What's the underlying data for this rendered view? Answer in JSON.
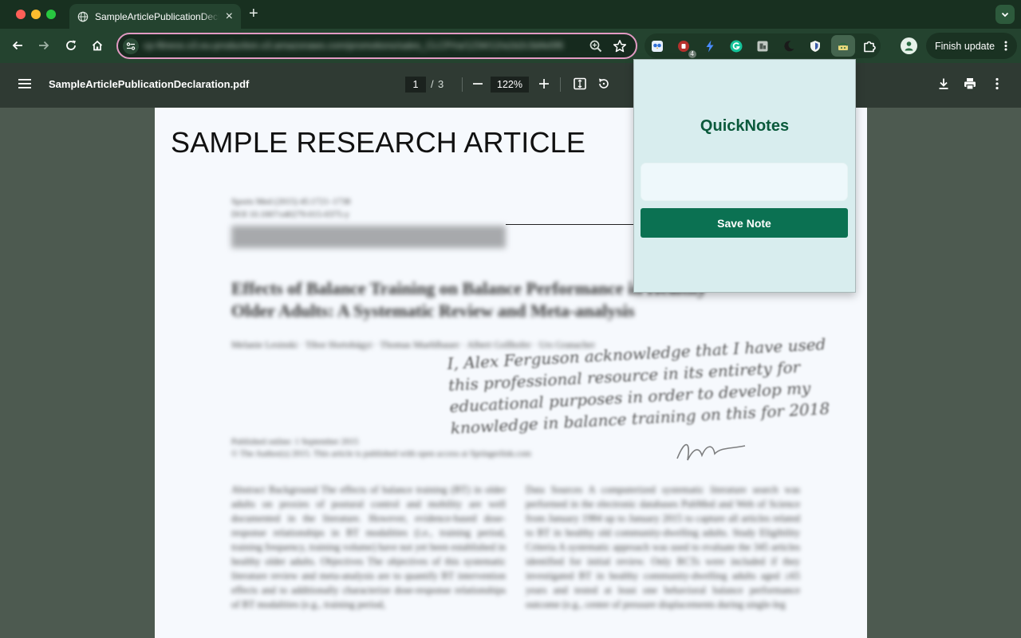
{
  "browser": {
    "tab": {
      "title": "SampleArticlePublicationDeclaration"
    },
    "address_bar": {
      "url": "cp-fitness.s3.eu-production.s3.amazonaws.com/promotions/sales_CLCP/ra/1234/12/a1b2c3d4e5f6"
    },
    "finish_update_label": "Finish update",
    "extension_badge_count": "4"
  },
  "pdf_viewer": {
    "filename": "SampleArticlePublicationDeclaration.pdf",
    "current_page": "1",
    "page_separator": "/",
    "total_pages": "3",
    "zoom": "122%"
  },
  "document": {
    "heading": "SAMPLE RESEARCH ARTICLE",
    "meta_line1": "Sports Med (2015) 45:1721–1738",
    "meta_line2": "DOI 10.1007/s40279-015-0375-y",
    "article_title": "Effects of Balance Training on Balance Performance in Healthy Older Adults: A Systematic Review and Meta-analysis",
    "authors": "Melanie Lesinski · Tibor Hortobágyi · Thomas Muehlbauer · Albert Gollhofer · Urs Granacher",
    "published_line1": "Published online: 1 September 2015",
    "published_line2": "© The Author(s) 2015. This article is published with open access at Springerlink.com",
    "abstract_left": "Abstract Background The effects of balance training (BT) in older adults on proxies of postural control and mobility are well documented in the literature. However, evidence-based dose-response relationships in BT modalities (i.e., training period, training frequency, training volume) have not yet been established in healthy older adults. Objectives The objectives of this systematic literature review and meta-analysis are to quantify BT intervention effects and to additionally characterize dose-response relationships of BT modalities (e.g., training period,",
    "abstract_right": "Data Sources A computerized systematic literature search was performed in the electronic databases PubMed and Web of Science from January 1984 up to January 2015 to capture all articles related to BT in healthy old community-dwelling adults. Study Eligibility Criteria A systematic approach was used to evaluate the 345 articles identified for initial review. Only RCTs were included if they investigated BT in healthy community-dwelling adults aged ≥65 years and tested at least one behavioral balance performance outcome (e.g., center of pressure displacements during single-leg",
    "handwritten_note": "I, Alex Ferguson acknowledge that I have used this professional resource in its entirety for educational purposes in order to develop my knowledge in balance training on this for 2018"
  },
  "popup": {
    "title": "QuickNotes",
    "note_placeholder": "",
    "save_label": "Save Note"
  },
  "colors": {
    "accent": "#0b7152",
    "popup_background": "#d8edee",
    "omnibox_border": "#e29ac3",
    "toolbar": "#24432f"
  }
}
